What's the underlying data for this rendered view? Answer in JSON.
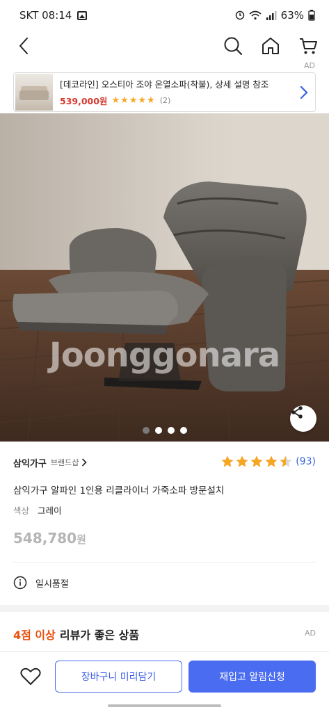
{
  "status_bar": {
    "carrier_time": "SKT 08:14",
    "battery": "63%"
  },
  "ad_banner": {
    "ad_label": "AD",
    "title": "[데코라인] 오스티아 조야 온열소파(착불), 상세 설명 참조",
    "price": "539,000원",
    "stars": "★★★★★",
    "review_count": "(2)"
  },
  "hero": {
    "watermark": "Joonggonara",
    "page_count": 4,
    "active_index": 0
  },
  "product": {
    "brand_name": "삼익가구",
    "brand_shop": "브랜드샵",
    "rating_value": 4.5,
    "rating_count": "(93)",
    "name": "삼익가구 알파인 1인용 리클라이너 가죽소파 방문설치",
    "option_label": "색상",
    "option_value": "그레이",
    "price": "548,780",
    "price_unit": "원",
    "stock_status": "일시품절"
  },
  "recommend": {
    "highlight": "4점 이상",
    "title": "리뷰가 좋은 상품",
    "ad_label": "AD"
  },
  "bottom_bar": {
    "cart_label": "장바구니 미리담기",
    "alert_label": "재입고 알림신청"
  },
  "colors": {
    "accent": "#4a6cf0",
    "star": "#f5a623",
    "ad_price": "#d43a2e",
    "highlight_orange": "#e8520e",
    "rating_count": "#3a64d8"
  }
}
